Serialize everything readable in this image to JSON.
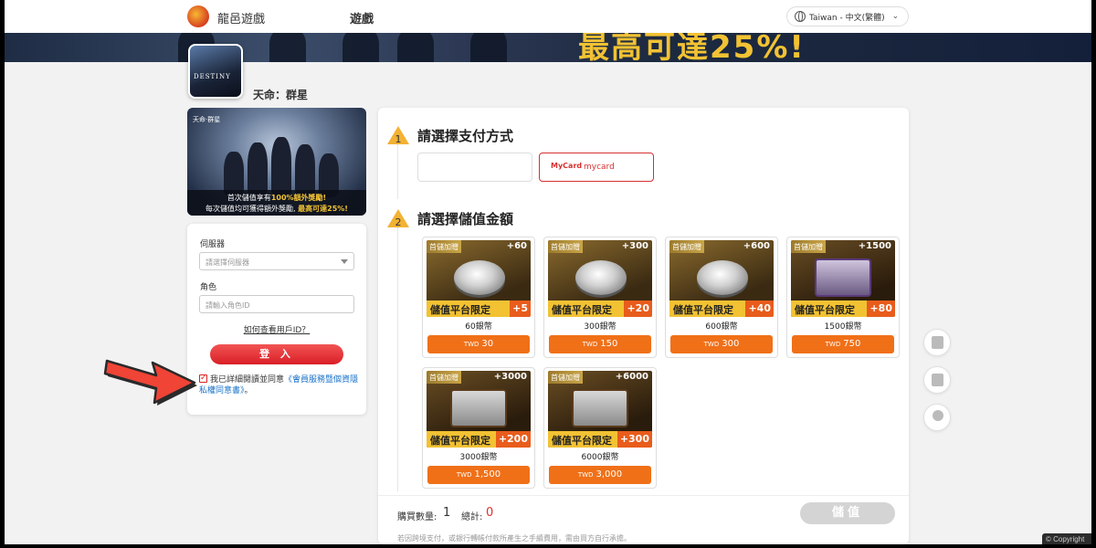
{
  "header": {
    "brand": "龍邑遊戲",
    "nav_games": "遊戲",
    "language": "Taiwan - 中文(繁體)",
    "banner_text": "最高可達25%!"
  },
  "game": {
    "title": "天命：群星",
    "icon_word": "DESTINY"
  },
  "promo": {
    "tag": "天命·群星",
    "line1_pre": "首次儲值享有",
    "line1_hl": "100%額外獎勵!",
    "line2_pre": "每次儲值均可獲得額外獎勵, ",
    "line2_hl": "最高可達25%!"
  },
  "login": {
    "server_label": "伺服器",
    "server_placeholder": "請選擇伺服器",
    "role_label": "角色",
    "role_placeholder": "請輸入角色ID",
    "how_to_id": "如何查看用戶ID？",
    "login_button": "登 入",
    "agree_text": "我已詳細閱讀並同意",
    "agree_link": "《會員服務暨個資隱私權同意書》",
    "agree_end": "。"
  },
  "steps": {
    "step1_num": "1",
    "step1_title": "請選擇支付方式",
    "step2_num": "2",
    "step2_title": "請選擇儲值金額"
  },
  "payment": {
    "mycard_logo": "MyCard",
    "mycard_label": "mycard"
  },
  "items": [
    {
      "ribbon": "首儲加贈",
      "plus": "+60",
      "limit": "儲值平台限定",
      "bonus": "+5",
      "name": "60銀幣",
      "currency": "TWD",
      "price": "30"
    },
    {
      "ribbon": "首儲加贈",
      "plus": "+300",
      "limit": "儲值平台限定",
      "bonus": "+20",
      "name": "300銀幣",
      "currency": "TWD",
      "price": "150"
    },
    {
      "ribbon": "首儲加贈",
      "plus": "+600",
      "limit": "儲值平台限定",
      "bonus": "+40",
      "name": "600銀幣",
      "currency": "TWD",
      "price": "300"
    },
    {
      "ribbon": "首儲加贈",
      "plus": "+1500",
      "limit": "儲值平台限定",
      "bonus": "+80",
      "name": "1500銀幣",
      "currency": "TWD",
      "price": "750"
    },
    {
      "ribbon": "首儲加贈",
      "plus": "+3000",
      "limit": "儲值平台限定",
      "bonus": "+200",
      "name": "3000銀幣",
      "currency": "TWD",
      "price": "1,500"
    },
    {
      "ribbon": "首儲加贈",
      "plus": "+6000",
      "limit": "儲值平台限定",
      "bonus": "+300",
      "name": "6000銀幣",
      "currency": "TWD",
      "price": "3,000"
    }
  ],
  "summary": {
    "qty_label": "購買數量:",
    "qty_value": "1",
    "total_label": "總計:",
    "total_value": "0",
    "pay_button": "儲值",
    "footnote": "若因跨境支付，或銀行轉帳付款所產生之手續費用，需由買方自行承擔。"
  },
  "copyright": "© Copyright",
  "colors": {
    "accent_red": "#d91f26",
    "price_orange": "#f07018",
    "gold": "#f2c233"
  }
}
